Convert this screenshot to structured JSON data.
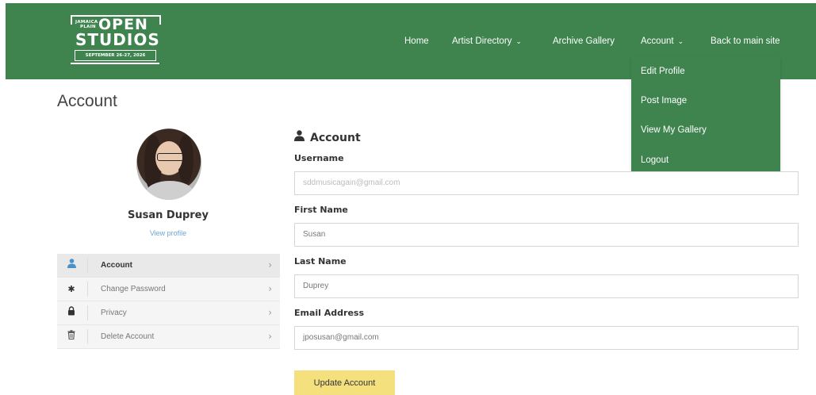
{
  "logo": {
    "line1": "JAMAICA",
    "line2": "PLAIN",
    "open": "OPEN",
    "studios": "STUDIOS",
    "dates": "SEPTEMBER 26-27, 2026"
  },
  "nav": {
    "items": [
      {
        "label": "Home"
      },
      {
        "label": "Artist Directory",
        "chevron": "⌄"
      },
      {
        "label": "Archive Gallery"
      },
      {
        "label": "Account",
        "chevron": "⌄"
      },
      {
        "label": "Back to main site"
      }
    ]
  },
  "dropdown": {
    "items": [
      {
        "label": "Edit Profile"
      },
      {
        "label": "Post Image"
      },
      {
        "label": "View My Gallery"
      },
      {
        "label": "Logout"
      }
    ]
  },
  "page": {
    "title": "Account"
  },
  "profile": {
    "name": "Susan Duprey",
    "view_profile": "View profile"
  },
  "side_menu": {
    "items": [
      {
        "label": "Account",
        "icon": "person-icon",
        "glyph": "👤",
        "active": true,
        "chevron": "›"
      },
      {
        "label": "Change Password",
        "icon": "asterisk-icon",
        "glyph": "✱",
        "chevron": "›"
      },
      {
        "label": "Privacy",
        "icon": "lock-icon",
        "glyph": "🔒",
        "chevron": "›"
      },
      {
        "label": "Delete Account",
        "icon": "trash-icon",
        "glyph": "🗑",
        "chevron": "›"
      }
    ]
  },
  "form": {
    "heading": "Account",
    "fields": [
      {
        "label": "Username",
        "value": "sddmusicagain@gmail.com"
      },
      {
        "label": "First Name",
        "value": "Susan"
      },
      {
        "label": "Last Name",
        "value": "Duprey"
      },
      {
        "label": "Email Address",
        "value": "jposusan@gmail.com"
      }
    ],
    "submit_label": "Update Account"
  },
  "colors": {
    "header": "#3f844f",
    "button": "#f5e07e",
    "link": "#6aa6d6"
  }
}
